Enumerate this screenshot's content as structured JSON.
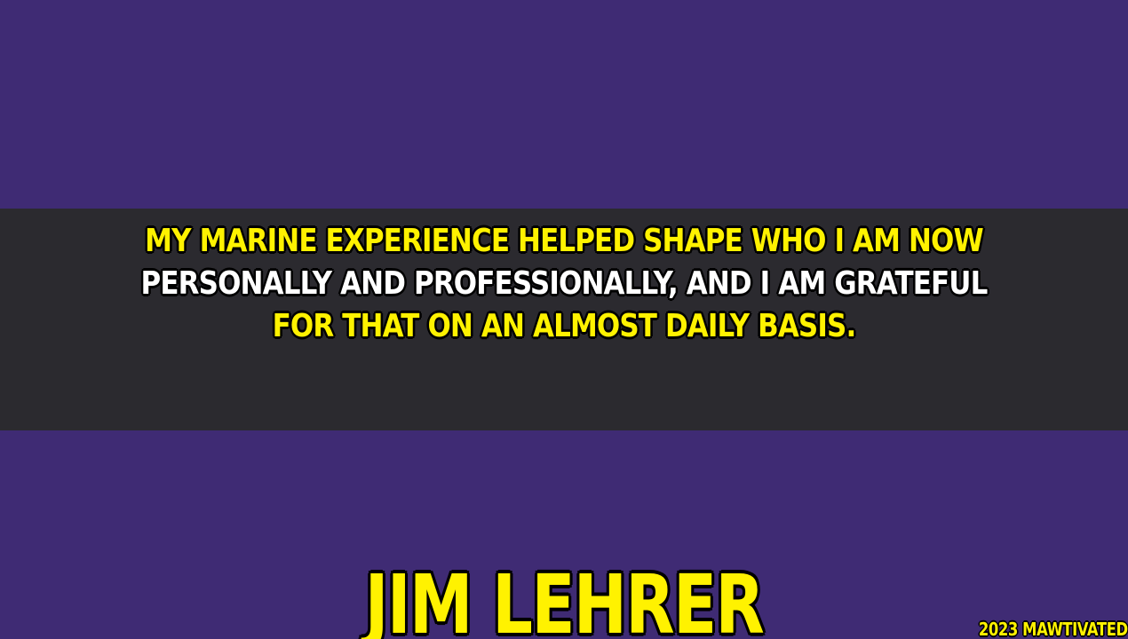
{
  "colors": {
    "background": "#3f2b74",
    "band": "#2b2a2f",
    "yellow": "#fff200",
    "white": "#ffffff",
    "outline": "#000000"
  },
  "quote": {
    "lines": [
      {
        "text": "MY MARINE EXPERIENCE HELPED SHAPE WHO I AM NOW",
        "color": "#fff200"
      },
      {
        "text": "PERSONALLY AND PROFESSIONALLY, AND I AM GRATEFUL",
        "color": "#ffffff"
      },
      {
        "text": "FOR THAT ON AN ALMOST DAILY BASIS.",
        "color": "#fff200"
      }
    ]
  },
  "author": {
    "name": "JIM LEHRER"
  },
  "watermark": {
    "text": "2023 MAWTIVATED"
  }
}
